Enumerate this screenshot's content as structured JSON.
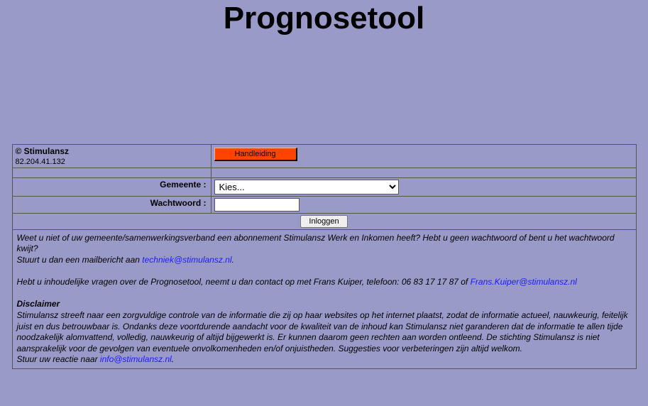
{
  "header": {
    "title": "Prognosetool"
  },
  "meta": {
    "copyright": "© Stimulansz",
    "ip": "82.204.41.132"
  },
  "buttons": {
    "handleiding": "Handleiding",
    "inloggen": "Inloggen"
  },
  "form": {
    "gemeente_label": "Gemeente :",
    "gemeente_selected": "Kies...",
    "wachtwoord_label": "Wachtwoord :",
    "wachtwoord_value": ""
  },
  "info": {
    "p1a": "Weet u niet of uw gemeente/samenwerkingsverband een abonnement Stimulansz Werk en Inkomen heeft? Hebt u geen wachtwoord of bent u het wachtwoord kwijt?",
    "p1b": "Stuurt u dan een mailbericht aan ",
    "mail1": "techniek@stimulansz.nl",
    "p2a": "Hebt u inhoudelijke vragen over de Prognosetool, neemt u dan contact op met Frans Kuiper, telefoon: 06 83 17 17 87 of ",
    "mail2": "Frans.Kuiper@stimulansz.nl",
    "disclaimer_h": "Disclaimer",
    "disclaimer_body": "Stimulansz streeft naar een zorgvuldige controle van de informatie die zij op haar websites op het internet plaatst, zodat de informatie actueel, nauwkeurig, feitelijk juist en dus betrouwbaar is. Ondanks deze voortdurende aandacht voor de kwaliteit van de inhoud kan Stimulansz niet garanderen dat de informatie te allen tijde noodzakelijk alomvattend, volledig, nauwkeurig of altijd bijgewerkt is. Er kunnen daarom geen rechten aan worden ontleend. De stichting Stimulansz is niet aansprakelijk voor de gevolgen van eventuele onvolkomenheden en/of onjuistheden. Suggesties voor verbeteringen zijn altijd welkom.",
    "p3": "Stuur uw reactie naar ",
    "mail3": "info@stimulansz.nl"
  }
}
